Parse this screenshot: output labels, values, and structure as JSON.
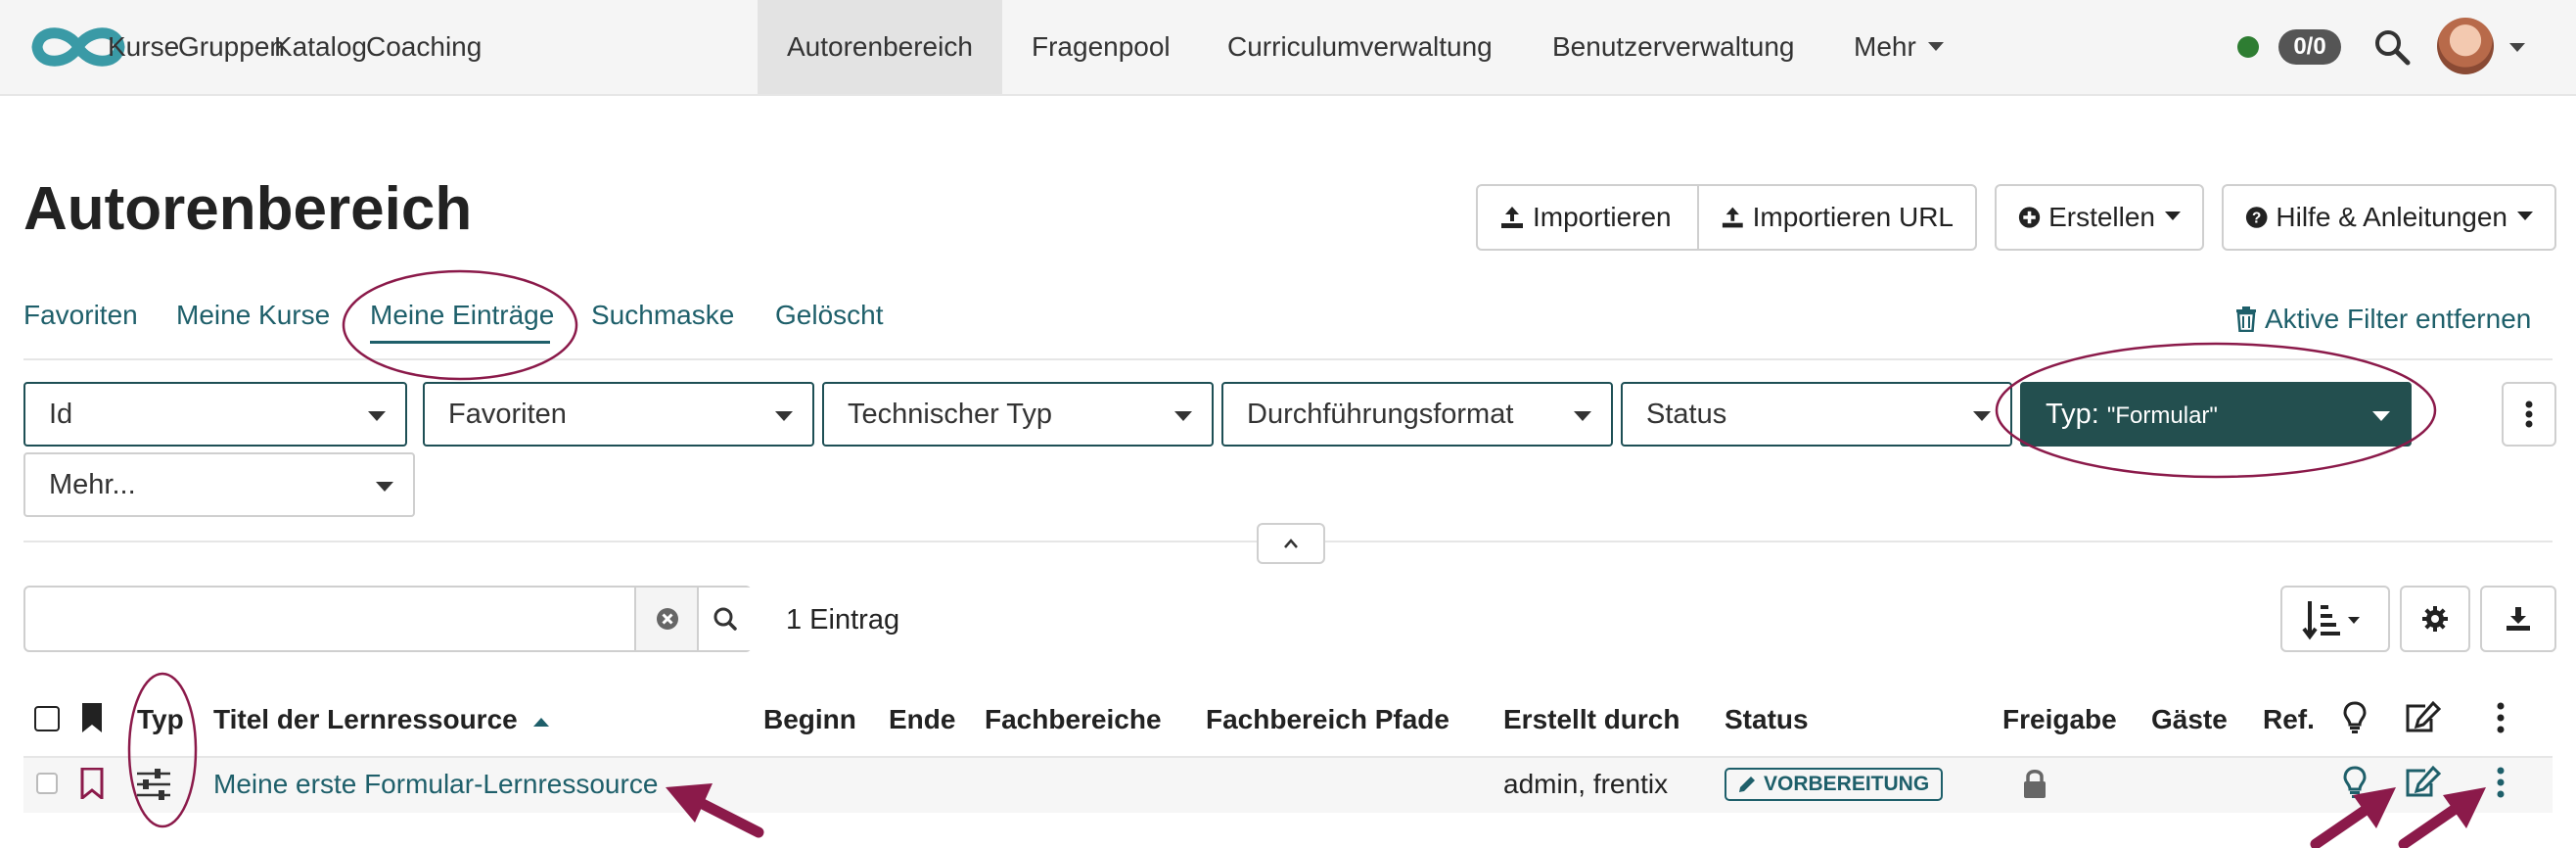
{
  "nav": {
    "items": [
      {
        "label": "Kurse"
      },
      {
        "label": "Gruppen"
      },
      {
        "label": "Katalog"
      },
      {
        "label": "Coaching"
      },
      {
        "label": "Autorenbereich"
      },
      {
        "label": "Fragenpool"
      },
      {
        "label": "Curriculumverwaltung"
      },
      {
        "label": "Benutzerverwaltung"
      },
      {
        "label": "Mehr"
      }
    ],
    "active": "Autorenbereich",
    "count_badge": "0/0",
    "status_color": "#2e7d32"
  },
  "page": {
    "title": "Autorenbereich"
  },
  "toolbar": {
    "import_label": "Importieren",
    "import_url_label": "Importieren URL",
    "create_label": "Erstellen",
    "help_label": "Hilfe & Anleitungen"
  },
  "tabs": {
    "items": [
      {
        "label": "Favoriten"
      },
      {
        "label": "Meine Kurse"
      },
      {
        "label": "Meine Einträge"
      },
      {
        "label": "Suchmaske"
      },
      {
        "label": "Gelöscht"
      }
    ],
    "active": "Meine Einträge",
    "reset_filters_label": "Aktive Filter entfernen"
  },
  "filters": {
    "items": [
      {
        "label": "Id"
      },
      {
        "label": "Favoriten"
      },
      {
        "label": "Technischer Typ"
      },
      {
        "label": "Durchführungsformat"
      },
      {
        "label": "Status"
      }
    ],
    "type_filter": {
      "label": "Typ:",
      "value": "\"Formular\""
    },
    "more_label": "Mehr..."
  },
  "search": {
    "value": "",
    "placeholder": ""
  },
  "results": {
    "count_label": "1 Eintrag"
  },
  "table": {
    "headers": {
      "typ": "Typ",
      "title": "Titel der Lernressource",
      "begin": "Beginn",
      "end": "Ende",
      "subjects": "Fachbereiche",
      "subject_paths": "Fachbereich Pfade",
      "created_by": "Erstellt durch",
      "status": "Status",
      "release": "Freigabe",
      "guests": "Gäste",
      "ref": "Ref."
    },
    "rows": [
      {
        "title": "Meine erste Formular-Lernressource",
        "created_by": "admin, frentix",
        "status": "VORBEREITUNG"
      }
    ]
  },
  "colors": {
    "accent": "#1e5f6a",
    "filter_active": "#234f4f",
    "annotation": "#8b1a4a"
  },
  "icons": {
    "logo": "infinity-logo",
    "search": "search-icon",
    "upload": "upload-icon",
    "plus": "plus-circle-icon",
    "help": "question-circle-icon",
    "trash": "trash-icon",
    "kebab": "kebab-icon",
    "sort": "sort-icon",
    "gear": "gear-icon",
    "download": "download-icon",
    "bookmark": "bookmark-icon",
    "type": "form-type-icon",
    "lightbulb": "lightbulb-icon",
    "edit": "edit-icon",
    "lock": "lock-icon",
    "pencil": "pencil-icon"
  }
}
